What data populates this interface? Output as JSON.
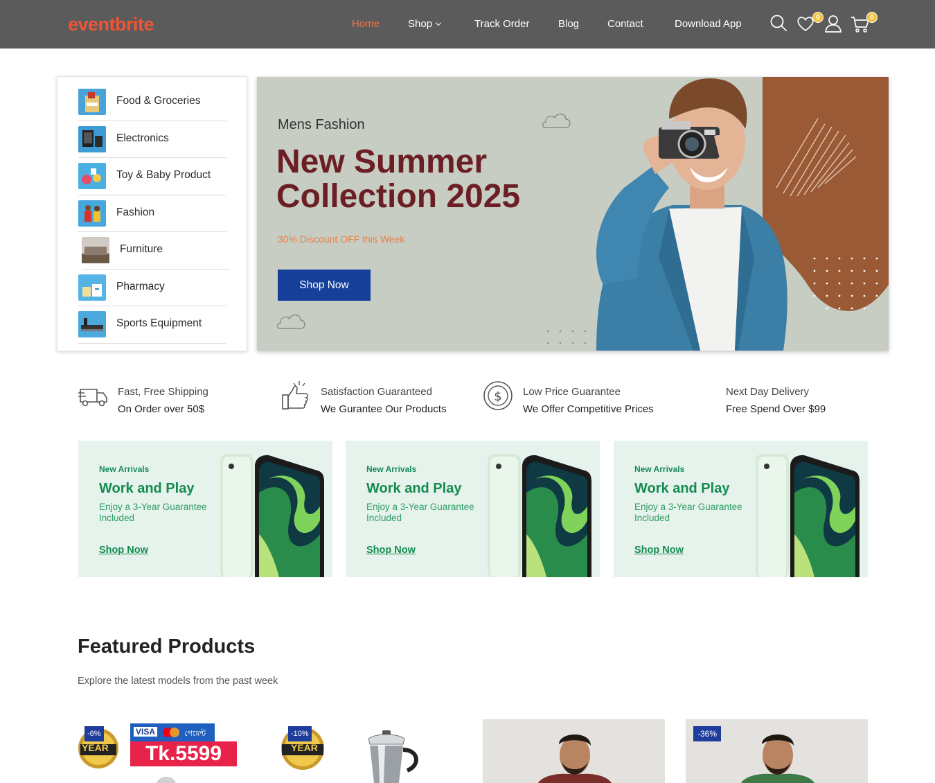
{
  "header": {
    "logo": "eventbrite",
    "nav": [
      {
        "label": "Home",
        "active": true
      },
      {
        "label": "Shop",
        "has_dropdown": true
      },
      {
        "label": "Track Order"
      },
      {
        "label": "Blog"
      },
      {
        "label": "Contact"
      },
      {
        "label": "Download App"
      }
    ],
    "icons": [
      "search-icon",
      "heart-icon",
      "user-icon",
      "cart-icon"
    ],
    "wishlist_count": "0",
    "cart_count": "0"
  },
  "categories": [
    {
      "label": "Food & Groceries",
      "icon": "food-groceries-thumb"
    },
    {
      "label": "Electronics",
      "icon": "electronics-thumb"
    },
    {
      "label": "Toy & Baby Product",
      "icon": "toy-baby-thumb"
    },
    {
      "label": "Fashion",
      "icon": "fashion-thumb"
    },
    {
      "label": "Furniture",
      "icon": "furniture-thumb"
    },
    {
      "label": "Pharmacy",
      "icon": "pharmacy-thumb"
    },
    {
      "label": "Sports Equipment",
      "icon": "sports-equipment-thumb"
    }
  ],
  "hero": {
    "subtitle": "Mens Fashion",
    "title": "New Summer Collection 2025",
    "discount": "30% Discount OFF this Week",
    "button": "Shop Now"
  },
  "features": [
    {
      "title": "Fast, Free Shipping",
      "subtitle": "On Order over 50$",
      "icon": "truck-icon"
    },
    {
      "title": "Satisfaction Guaranteed",
      "subtitle": "We Gurantee Our Products",
      "icon": "thumbs-up-icon"
    },
    {
      "title": "Low Price Guarantee",
      "subtitle": "We Offer Competitive Prices",
      "icon": "dollar-circle-icon"
    },
    {
      "title": "Next Day Delivery",
      "subtitle": "Free Spend Over $99",
      "icon": ""
    }
  ],
  "promos": [
    {
      "eyebrow": "New Arrivals",
      "title": "Work and Play",
      "desc": "Enjoy a 3-Year Guarantee Included",
      "link": "Shop Now"
    },
    {
      "eyebrow": "New Arrivals",
      "title": "Work and Play",
      "desc": "Enjoy a 3-Year Guarantee Included",
      "link": "Shop Now"
    },
    {
      "eyebrow": "New Arrivals",
      "title": "Work and Play",
      "desc": "Enjoy a 3-Year Guarantee Included",
      "link": "Shop Now"
    }
  ],
  "featured": {
    "title": "Featured Products",
    "subtitle": "Explore the latest models from the past week"
  },
  "products": [
    {
      "discount": "-6%",
      "warranty": "YEAR",
      "price": "Tk.5599",
      "pay_text": "VISA",
      "bangla": "পেমেন্ট"
    },
    {
      "discount": "-10%",
      "warranty": "YEAR"
    },
    {
      "discount": ""
    },
    {
      "discount": "-36%"
    }
  ],
  "colors": {
    "header_bg": "#5b5b5b",
    "brand": "#f05537",
    "hero_title": "#6b1f24",
    "hero_button": "#163f9a",
    "promo_bg": "#e6f3ec",
    "promo_green": "#138a50"
  }
}
